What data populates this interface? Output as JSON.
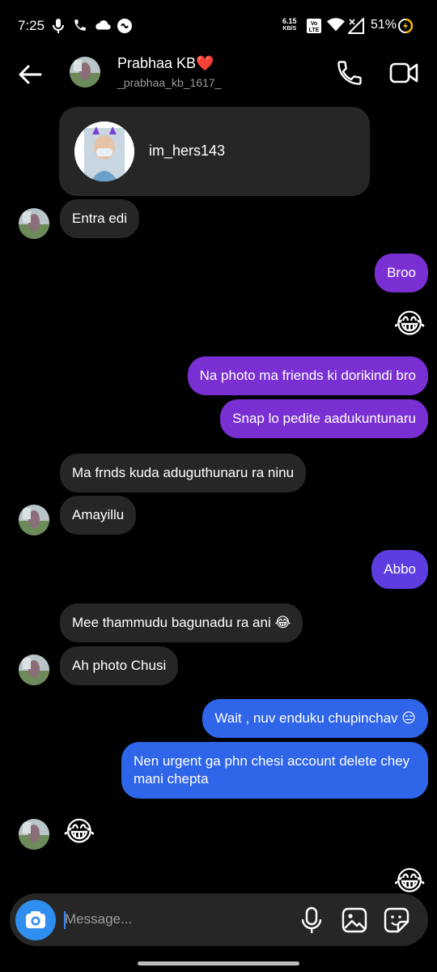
{
  "status_bar": {
    "time": "7:25",
    "net_speed": "6.15",
    "net_unit": "KB/S",
    "battery": "51%",
    "icons": [
      "mic-icon",
      "phone-icon",
      "cloud-icon",
      "link-icon",
      "volte-icon",
      "wifi-icon",
      "signal-icon",
      "battery-icon"
    ]
  },
  "header": {
    "name": "Prabhaa KB❤️",
    "username": "_prabhaa_kb_1617_"
  },
  "shared_profile": {
    "username": "im_hers143"
  },
  "messages": [
    {
      "id": "m1",
      "sender": "them",
      "text": "Entra edi"
    },
    {
      "id": "m2",
      "sender": "me",
      "text": "Broo"
    },
    {
      "id": "m3",
      "sender": "me",
      "text": "😂"
    },
    {
      "id": "m4",
      "sender": "me",
      "text": "Na photo ma friends ki dorikindi bro"
    },
    {
      "id": "m5",
      "sender": "me",
      "text": "Snap lo pedite aadukuntunaru"
    },
    {
      "id": "m6",
      "sender": "them",
      "text": "Ma frnds kuda aduguthunaru ra ninu"
    },
    {
      "id": "m7",
      "sender": "them",
      "text": "Amayillu"
    },
    {
      "id": "m8",
      "sender": "me",
      "text": "Abbo"
    },
    {
      "id": "m9",
      "sender": "them",
      "text": "Mee thammudu bagunadu ra ani 😂"
    },
    {
      "id": "m10",
      "sender": "them",
      "text": "Ah photo Chusi"
    },
    {
      "id": "m11",
      "sender": "me",
      "text": "Wait , nuv enduku chupinchav 😑"
    },
    {
      "id": "m12",
      "sender": "me",
      "text": "Nen urgent ga phn chesi account delete chey mani chepta"
    },
    {
      "id": "m13",
      "sender": "them",
      "text": "😂"
    },
    {
      "id": "m14",
      "sender": "me",
      "text": "😂"
    }
  ],
  "composer": {
    "placeholder": "Message..."
  },
  "colors": {
    "background": "#000000",
    "incoming_bubble": "#262626",
    "outgoing_purple": "#7a2fd3",
    "outgoing_violet": "#5d3de0",
    "outgoing_blue": "#2f65e8",
    "camera_button": "#2f8ef0"
  }
}
